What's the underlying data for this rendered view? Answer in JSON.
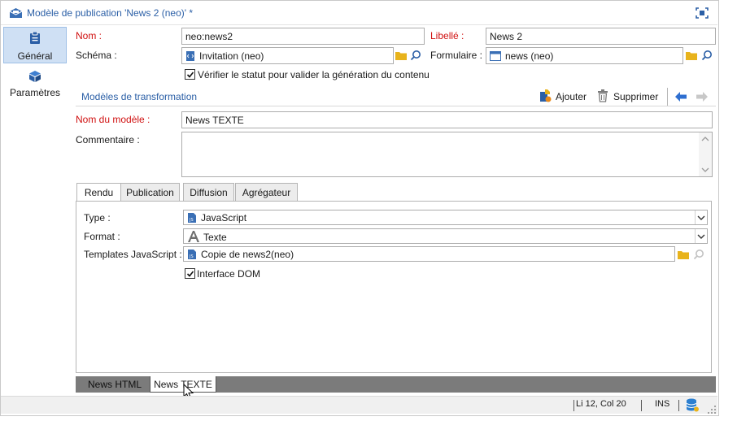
{
  "window": {
    "title": "Modèle de publication 'News 2 (neo)' *"
  },
  "sidebar": {
    "items": [
      {
        "label": "Général",
        "active": true
      },
      {
        "label": "Paramètres",
        "active": false
      }
    ]
  },
  "form": {
    "nom_label": "Nom :",
    "nom_value": "neo:news2",
    "libelle_label": "Libellé :",
    "libelle_value": "News 2",
    "schema_label": "Schéma :",
    "schema_value": "Invitation (neo)",
    "formulaire_label": "Formulaire :",
    "formulaire_value": "news (neo)",
    "verify_label": "Vérifier le statut pour valider la génération du contenu"
  },
  "transform": {
    "section_title": "Modèles de transformation",
    "add_label": "Ajouter",
    "delete_label": "Supprimer",
    "model_name_label": "Nom du modèle :",
    "model_name_value": "News TEXTE",
    "comment_label": "Commentaire :",
    "comment_value": ""
  },
  "tabs": [
    "Rendu",
    "Publication",
    "Diffusion",
    "Agrégateur"
  ],
  "rendu": {
    "type_label": "Type :",
    "type_value": "JavaScript",
    "format_label": "Format :",
    "format_value": "Texte",
    "templates_label": "Templates JavaScript :",
    "templates_value": "Copie de news2(neo)",
    "dom_label": "Interface DOM"
  },
  "bottom_tabs": [
    "News HTML",
    "News TEXTE"
  ],
  "status": {
    "position": "Li 12, Col 20",
    "mode": "INS"
  },
  "colors": {
    "accent": "#2b5fa6",
    "required": "#d01010",
    "active_side": "#cfe0f4",
    "arrow": "#2f6fd0"
  }
}
